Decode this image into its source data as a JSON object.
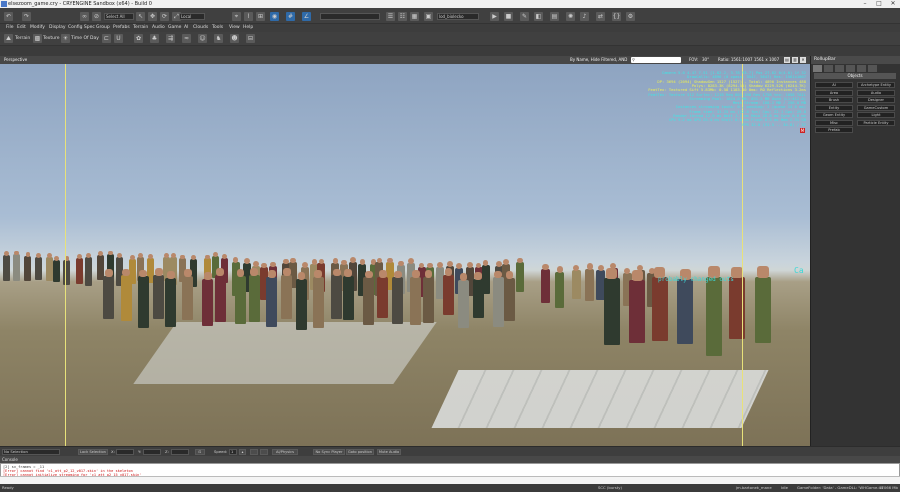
{
  "window": {
    "title": "elsezoom_game.cry - CRYENGINE Sandbox (x64) - Build 0",
    "minimize_glyph": "–",
    "maximize_glyph": "□",
    "close_glyph": "✕"
  },
  "toolbar": {
    "coordinate_system": "Local",
    "level_name": "lod_biolecko",
    "icons": [
      "undo-icon",
      "redo-icon",
      "select-icon",
      "move-icon",
      "rotate-icon",
      "scale-icon",
      "snap-icon",
      "terrain-icon",
      "camera-icon",
      "grid-icon",
      "physics-icon",
      "ai-icon",
      "play-icon"
    ]
  },
  "menu": [
    "File",
    "Edit",
    "Modify",
    "Display",
    "Config Spec",
    "Group",
    "Prefabs",
    "Terrain",
    "Audio",
    "Game",
    "AI",
    "Clouds",
    "Tools",
    "View",
    "Help"
  ],
  "toolbar2": {
    "terrain": "Terrain",
    "texture": "Texture",
    "time_of_day": "Time Of Day"
  },
  "viewport": {
    "label": "Perspective",
    "filter": "By Name, Hide Filtered, AND",
    "fov": "FOV:",
    "fov_value": "30°",
    "ratio": "Ratio: 1561:1007  1561 x 1007",
    "debug_info": [
      {
        "text": "Camera 5.0 4.47 7.51 [1-82.2, 3.78 93.7] Pos 27.62 0(4.0) 1f 32",
        "color": "#3ee6e6"
      },
      {
        "text": "DrawCalls: 4896 (0 zpass: 3547, 5647) Res: 1561x1007",
        "color": "#3ee6e6"
      },
      {
        "text": "DP: 3694 (2094) ShadowGen 1527 (1527) - Total: 4890 Instances 488",
        "color": "#f0f050"
      },
      {
        "text": "Polys: 8283.3K (8294.5K) Shadow 6229.52K (6244.7K)",
        "color": "#f0f050"
      },
      {
        "text": "FeatTex: Textured Sift 5.83Mb: 0.58 1183.40 0ms: RO Reflections 3.2ms",
        "color": "#f0f050"
      },
      {
        "text": "FeatTex: Texture 512 Surfac: 1218 Req 801.198 Res 1758 tex: 1058 TAIL",
        "color": "#3ee6e6"
      },
      {
        "text": "Streaming Pool: 1024.0 MB: 891.2 MB Used (L1:412.8)",
        "color": "#3ee6e6"
      },
      {
        "text": "Mesh Stream: 168.2 MB / 256.0 MB",
        "color": "#3ee6e6"
      },
      {
        "text": "Instances streaming tasks: 0 / pending: 2 (queue 14 0 ms)",
        "color": "#3ee6e6"
      },
      {
        "text": "Frame time: 31.25 ms (32.0 fps) Cpu: 22.1 Gpu: 29.8",
        "color": "#3ee6e6"
      },
      {
        "text": "Render thread 12.9 ms Wait 1.2 ms Main 20.8 ms Sync 0.6 ms",
        "color": "#3ee6e6"
      },
      {
        "text": "CPU 9.2 ms GPU 25.4 ms Stall 0.0 ms Flush 0.3 ms Mem 2.51 GB",
        "color": "#3ee6e6"
      },
      {
        "text": "FPS 32.0 (31.5 .. 34.8) / 32",
        "color": "#3ee6e6"
      }
    ],
    "annotation": "probably changed outs",
    "annotation_right": "Ca"
  },
  "rollup": {
    "title": "RollupBar",
    "section": "Objects",
    "buttons": [
      {
        "left": "AI",
        "right": "Archetype Entity"
      },
      {
        "left": "Area",
        "right": "Audio"
      },
      {
        "left": "Brush",
        "right": "Designer"
      },
      {
        "left": "Entity",
        "right": "GameCustom"
      },
      {
        "left": "Geom Entity",
        "right": "Light"
      },
      {
        "left": "Misc",
        "right": "Particle Entity"
      },
      {
        "left": "Prefab",
        "right": ""
      }
    ]
  },
  "statusbar": {
    "selection": "No Selection",
    "lock": "Lock Selection",
    "x": "X:",
    "y": "Y:",
    "z": "Z:",
    "speed": "Speed:",
    "speed_value": "1",
    "physics": "AI/Physics",
    "sync": "No Sync Player",
    "goto": "Goto position",
    "mute": "Mute Audio"
  },
  "console": {
    "title": "Console",
    "lines": [
      {
        "text": "[2] sv_frames = _11",
        "color": "#333333"
      },
      {
        "text": "[Error] cannot find 'c1_att_p2_12_v017.skin' in the skeleton",
        "color": "#cc1111"
      },
      {
        "text": "[Error] cannot initialize streaming for 'c1_att_p2_15_v017.skin'",
        "color": "#cc1111"
      }
    ]
  },
  "bottombar": {
    "ready": "Ready",
    "scc": "SCC (bursty)",
    "user": "jm.bartonek_mane",
    "idle": "Idle",
    "gamefolder": "GameFolder: 'Data' - GameDLL: 'WHGame.dll'",
    "mem": "11066 Mb"
  }
}
